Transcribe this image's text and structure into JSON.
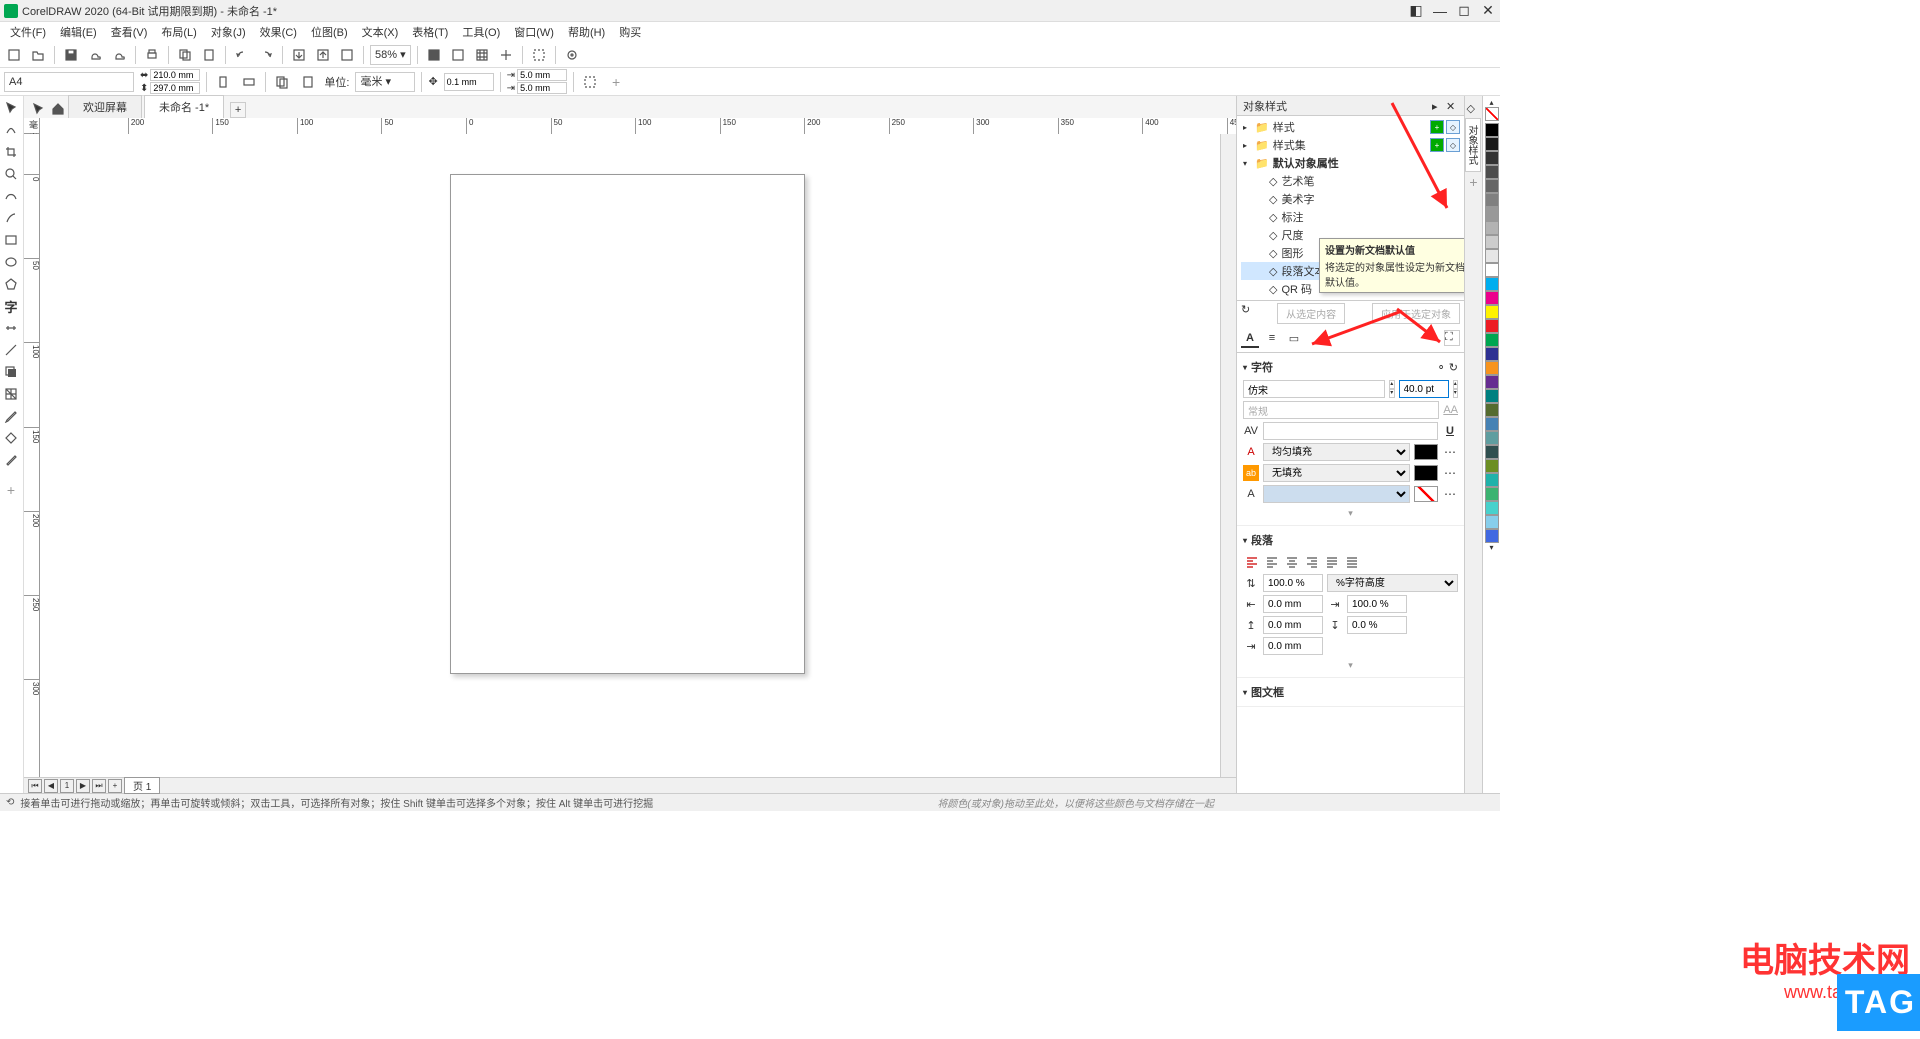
{
  "titlebar": {
    "text": "CorelDRAW 2020 (64-Bit 试用期限到期) - 未命名 -1*"
  },
  "menubar": {
    "items": [
      "文件(F)",
      "编辑(E)",
      "查看(V)",
      "布局(L)",
      "对象(J)",
      "效果(C)",
      "位图(B)",
      "文本(X)",
      "表格(T)",
      "工具(O)",
      "窗口(W)",
      "帮助(H)",
      "购买"
    ]
  },
  "toolbar1": {
    "zoom": "58%"
  },
  "toolbar2": {
    "pagesize": "A4",
    "width": "210.0 mm",
    "height": "297.0 mm",
    "unit_label": "单位:",
    "unit": "毫米",
    "nudge": "0.1 mm",
    "dup_x": "5.0 mm",
    "dup_y": "5.0 mm"
  },
  "tabs": {
    "welcome": "欢迎屏幕",
    "doc": "未命名 -1*"
  },
  "ruler_unit": "毫米",
  "pagenav": {
    "page1": "页 1",
    "count": "1"
  },
  "statusbar": {
    "hint": "接着单击可进行拖动或缩放；再单击可旋转或倾斜；双击工具，可选择所有对象；按住 Shift 键单击可选择多个对象；按住 Alt 键单击可进行挖掘",
    "hint2": "将颜色(或对象)拖动至此处，以便将这些颜色与文档存储在一起"
  },
  "rightpanel": {
    "title": "对象样式",
    "tree": {
      "styles": "样式",
      "stylesets": "样式集",
      "defaults": "默认对象属性",
      "items": [
        "艺术笔",
        "美术字",
        "标注",
        "尺度",
        "图形",
        "段落文本",
        "QR 码"
      ]
    },
    "tooltip": {
      "title": "设置为新文档默认值",
      "body": "将选定的对象属性设定为新文档的默认值。"
    },
    "btn_from": "从选定内容",
    "btn_apply": "应用于选定对象",
    "group_char": "字符",
    "font": "仿宋",
    "fontsize": "40.0 pt",
    "fontstyle": "常规",
    "fill_mode": "均匀填充",
    "outline_mode": "无填充",
    "group_para": "段落",
    "line_spacing": "100.0 %",
    "line_spacing_mode": "%字符高度",
    "indent_left": "0.0 mm",
    "indent_right": "100.0 %",
    "before": "0.0 mm",
    "after": "0.0 %",
    "first_indent": "0.0 mm",
    "group_frame": "图文框"
  },
  "sidetab": {
    "label": "对象样式"
  },
  "colors": [
    "#000000",
    "#1a1a1a",
    "#333333",
    "#4d4d4d",
    "#666666",
    "#808080",
    "#999999",
    "#b3b3b3",
    "#cccccc",
    "#e6e6e6",
    "#ffffff",
    "#00aeef",
    "#ec008c",
    "#fff200",
    "#ed1c24",
    "#00a651",
    "#2e3192",
    "#f7941d",
    "#662d91",
    "#008080",
    "#556b2f",
    "#4682b4",
    "#5f9ea0",
    "#2f4f4f",
    "#6b8e23",
    "#20b2aa",
    "#3cb371",
    "#48d1cc",
    "#87ceeb",
    "#4169e1"
  ],
  "watermark": {
    "text": "电脑技术网",
    "url": "www.tagxp.com"
  },
  "tag": "TAG"
}
